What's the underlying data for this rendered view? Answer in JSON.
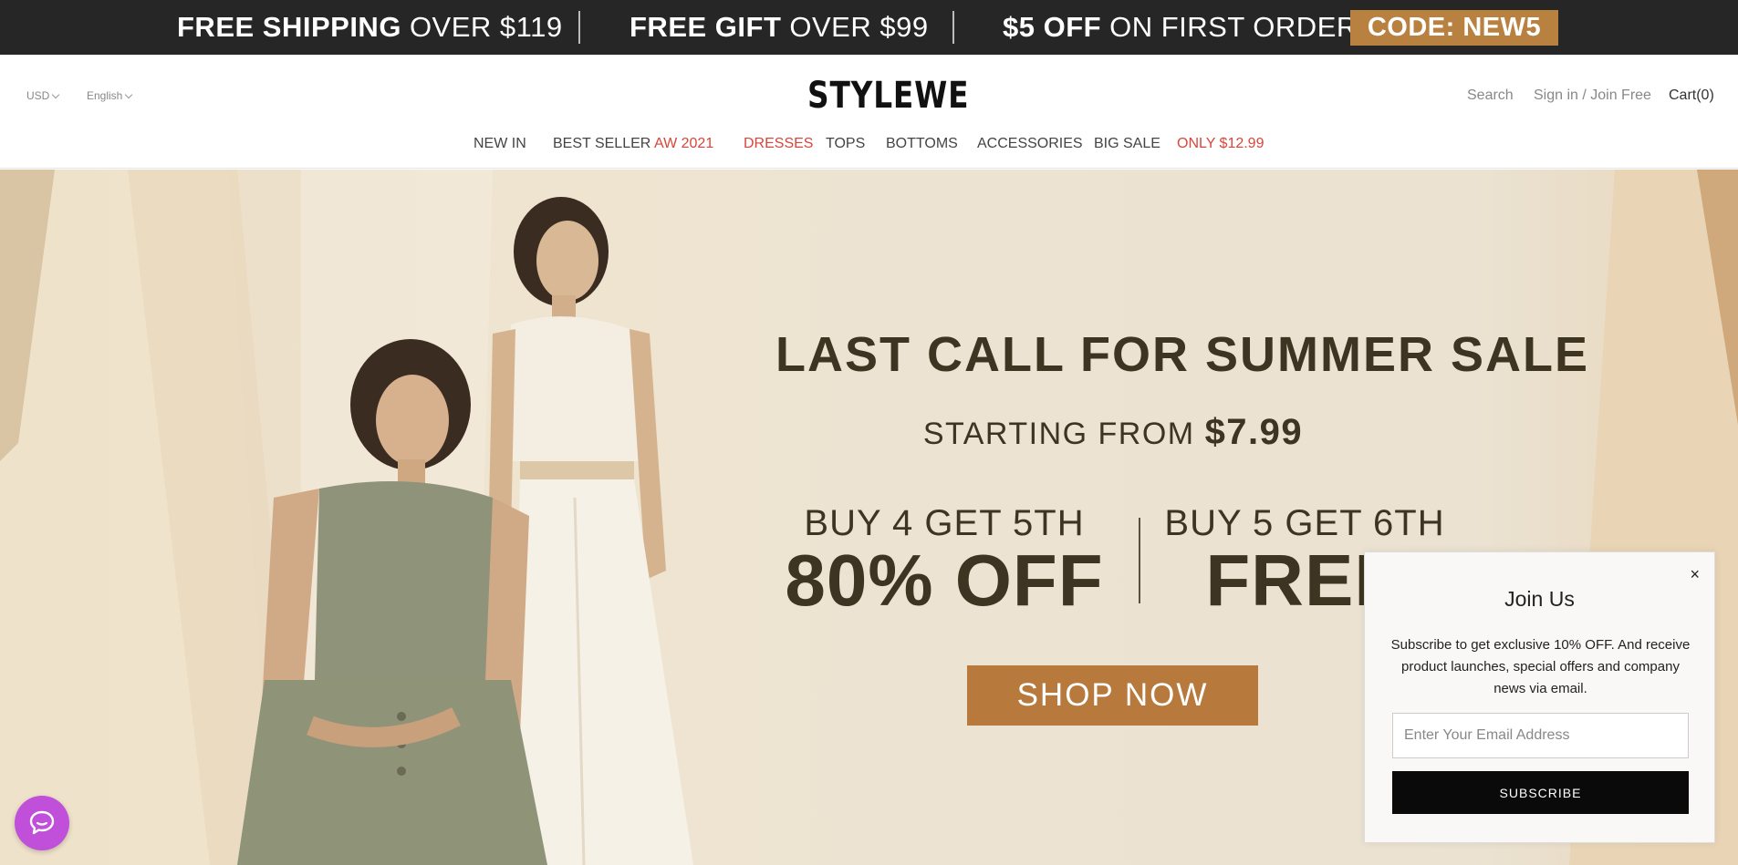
{
  "promo": {
    "items": [
      {
        "bold": "FREE SHIPPING",
        "light": "OVER $119"
      },
      {
        "bold": "FREE GIFT",
        "light": "OVER $99"
      },
      {
        "bold": "$5 OFF",
        "light": "ON FIRST ORDER"
      }
    ],
    "code": "CODE: NEW5"
  },
  "header": {
    "currency": "USD",
    "language": "English",
    "logo": "STYLEWE",
    "search": "Search",
    "account": "Sign in / Join Free",
    "cart": "Cart(0)"
  },
  "nav": [
    {
      "label": "NEW IN"
    },
    {
      "label": "BEST SELLER"
    },
    {
      "label": "AW 2021"
    },
    {
      "label": "DRESSES"
    },
    {
      "label": "TOPS"
    },
    {
      "label": "BOTTOMS"
    },
    {
      "label": "ACCESSORIES"
    },
    {
      "label": "BIG SALE"
    },
    {
      "label": "ONLY $12.99"
    }
  ],
  "hero": {
    "title": "LAST CALL FOR SUMMER SALE",
    "subtitle_prefix": "STARTING FROM",
    "subtitle_price": "$7.99",
    "deal1_small": "BUY 4 GET 5TH",
    "deal1_big": "80% OFF",
    "deal2_small": "BUY 5 GET 6TH",
    "deal2_big": "FREE",
    "cta": "SHOP NOW"
  },
  "popup": {
    "close": "×",
    "title": "Join Us",
    "text": "Subscribe to get exclusive 10% OFF. And receive product launches, special offers and company news via email.",
    "email_placeholder": "Enter Your Email Address",
    "button": "SUBSCRIBE"
  },
  "colors": {
    "promo_bg": "#262626",
    "code_bg": "#b8813f",
    "accent_red": "#d9453a",
    "cta_bg": "#b77a3c",
    "chat_bg": "#c04fd9"
  },
  "icons": {
    "chat": "chat-bubble-icon",
    "close": "close-icon",
    "dropdown": "chevron-down-icon"
  }
}
